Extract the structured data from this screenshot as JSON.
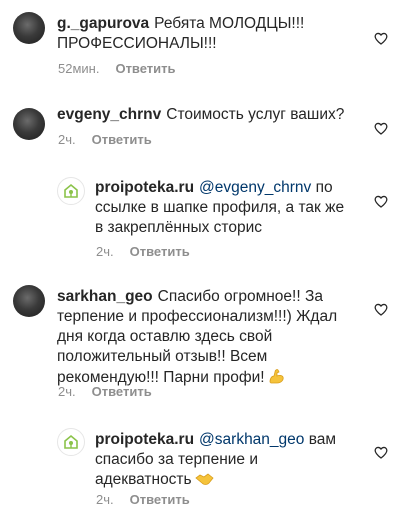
{
  "comments": [
    {
      "username": "g._gapurova",
      "text": "Ребята МОЛОДЦЫ!!! ПРОФЕССИОНАЛЫ!!!",
      "time": "52мин.",
      "reply_label": "Ответить"
    },
    {
      "username": "evgeny_chrnv",
      "text": "Стоимость услуг ваших?",
      "time": "2ч.",
      "reply_label": "Ответить"
    },
    {
      "username": "proipoteka.ru",
      "mention": "@evgeny_chrnv",
      "text": "по ссылке в шапке профиля, а так же в закреплённых сторис",
      "time": "2ч.",
      "reply_label": "Ответить"
    },
    {
      "username": "sarkhan_geo",
      "text": "Спасибо огромное!! За терпение и профессионализм!!!) Ждал дня когда оставлю здесь свой положительный отзыв!! Всем рекомендую!!! Парни профи!",
      "emoji": "flexed-biceps-icon",
      "time": "2ч.",
      "reply_label": "Ответить"
    },
    {
      "username": "proipoteka.ru",
      "mention": "@sarkhan_geo",
      "text": "вам спасибо за терпение и адекватность",
      "emoji": "handshake-icon",
      "time": "2ч.",
      "reply_label": "Ответить"
    }
  ],
  "colors": {
    "text": "#262626",
    "muted": "#8e8e8e",
    "mention": "#00376b",
    "brand_green": "#8bc34a"
  }
}
